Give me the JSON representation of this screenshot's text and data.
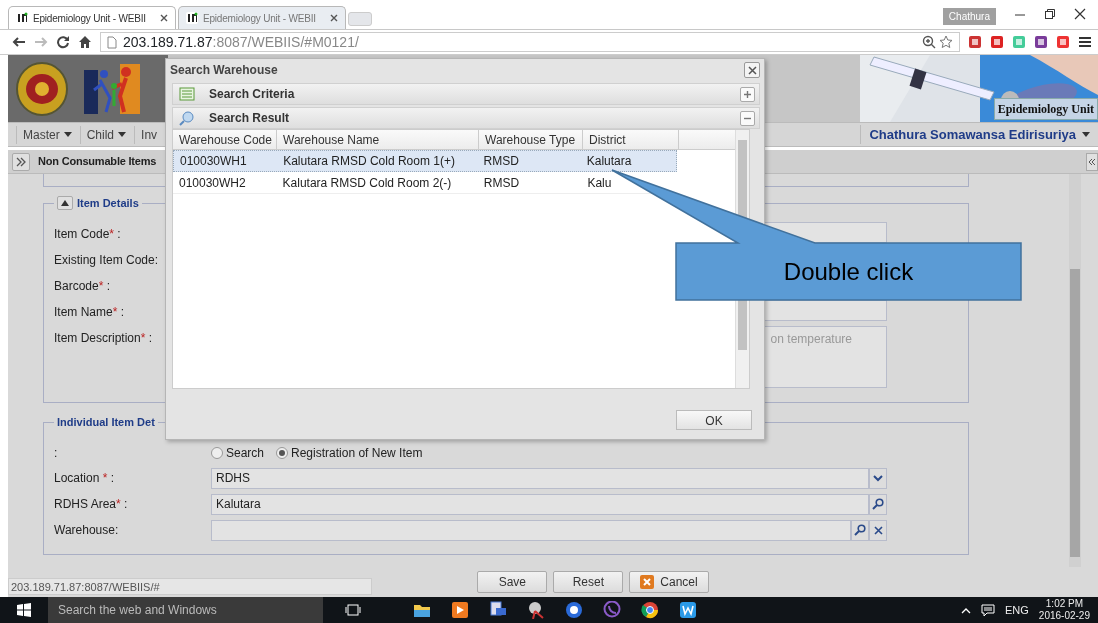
{
  "browser": {
    "tabs": [
      {
        "title": "Epidemiology Unit - WEBII",
        "selected": true
      },
      {
        "title": "Epidemiology Unit - WEBII",
        "selected": false
      }
    ],
    "profile": "Chathura",
    "url_host": "203.189.71.87",
    "url_rest": ":8087/WEBIIS/#M0121/"
  },
  "header": {
    "banner_title": "Epidemiology Unit"
  },
  "menu": {
    "items": [
      "Master",
      "Child",
      "Inv"
    ],
    "user": "Chathura Somawansa Edirisuriya"
  },
  "page": {
    "title": "Non Consumable Items"
  },
  "item_details": {
    "legend": "Item Details",
    "fields": [
      {
        "label": "Item Code",
        "mark": "*",
        "tail": " :",
        "kind": "input"
      },
      {
        "label": "Existing Item Code:"
      },
      {
        "label": "Barcode",
        "mark": "*",
        "tail": " :"
      },
      {
        "label": "Item Name",
        "mark": "*",
        "tail": " :",
        "kind": "input"
      },
      {
        "label": "Item Description",
        "mark": "*",
        "tail": " :",
        "kind": "textarea",
        "placeholder": "on temperature"
      }
    ]
  },
  "individual_details": {
    "legend": "Individual Item Det",
    "radio_label": ":",
    "options": [
      {
        "label": "Search",
        "selected": false
      },
      {
        "label": "Registration of New Item",
        "selected": true
      }
    ],
    "fields": [
      {
        "label": "Location ",
        "mark": "*",
        "tail": " :",
        "value": "RDHS",
        "kind": "dropdown"
      },
      {
        "label": "RDHS Area",
        "mark": "*",
        "tail": " :",
        "value": "Kalutara",
        "kind": "lookup"
      },
      {
        "label": "Warehouse:",
        "kind": "lookup_clear"
      }
    ]
  },
  "buttons": [
    {
      "label": "Save",
      "kind": "plain"
    },
    {
      "label": "Reset",
      "kind": "plain"
    },
    {
      "label": "Cancel",
      "kind": "cancel"
    }
  ],
  "status_url": "203.189.71.87:8087/WEBIIS/#",
  "dialog": {
    "title": "Search Warehouse",
    "sections": [
      {
        "title": "Search Criteria",
        "expanded": false,
        "kind": "criteria"
      },
      {
        "title": "Search Result",
        "expanded": true,
        "kind": "result"
      }
    ],
    "columns": [
      "Warehouse Code",
      "Warehouse Name",
      "Warehouse Type",
      "District"
    ],
    "rows": [
      {
        "cells": [
          "010030WH1",
          "Kalutara RMSD Cold Room 1(+)",
          "RMSD",
          "Kalutara"
        ],
        "selected": true
      },
      {
        "cells": [
          "010030WH2",
          "Kalutara RMSD Cold Room 2(-)",
          "RMSD",
          "Kalu"
        ],
        "selected": false
      }
    ],
    "ok": "OK"
  },
  "callout": {
    "text": "Double click"
  },
  "taskbar": {
    "search_placeholder": "Search the web and Windows",
    "language": "ENG",
    "time": "1:02 PM",
    "date": "2016-02-29"
  }
}
